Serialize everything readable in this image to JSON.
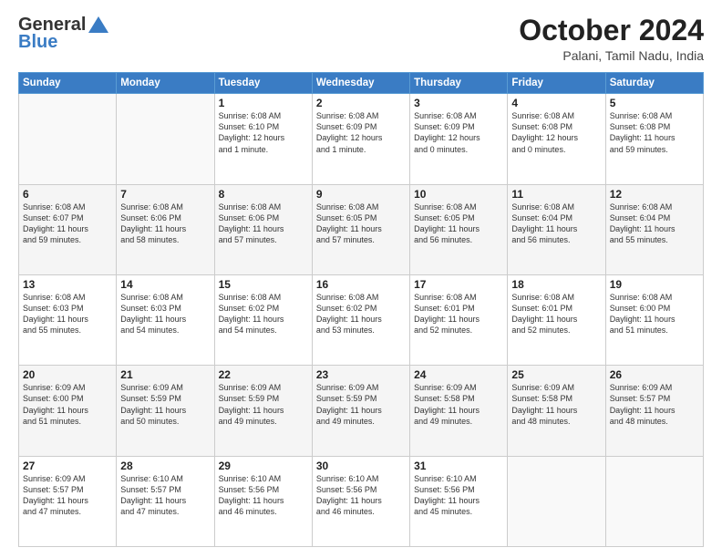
{
  "header": {
    "logo_line1": "General",
    "logo_line2": "Blue",
    "month": "October 2024",
    "location": "Palani, Tamil Nadu, India"
  },
  "weekdays": [
    "Sunday",
    "Monday",
    "Tuesday",
    "Wednesday",
    "Thursday",
    "Friday",
    "Saturday"
  ],
  "weeks": [
    [
      {
        "day": "",
        "text": ""
      },
      {
        "day": "",
        "text": ""
      },
      {
        "day": "1",
        "text": "Sunrise: 6:08 AM\nSunset: 6:10 PM\nDaylight: 12 hours\nand 1 minute."
      },
      {
        "day": "2",
        "text": "Sunrise: 6:08 AM\nSunset: 6:09 PM\nDaylight: 12 hours\nand 1 minute."
      },
      {
        "day": "3",
        "text": "Sunrise: 6:08 AM\nSunset: 6:09 PM\nDaylight: 12 hours\nand 0 minutes."
      },
      {
        "day": "4",
        "text": "Sunrise: 6:08 AM\nSunset: 6:08 PM\nDaylight: 12 hours\nand 0 minutes."
      },
      {
        "day": "5",
        "text": "Sunrise: 6:08 AM\nSunset: 6:08 PM\nDaylight: 11 hours\nand 59 minutes."
      }
    ],
    [
      {
        "day": "6",
        "text": "Sunrise: 6:08 AM\nSunset: 6:07 PM\nDaylight: 11 hours\nand 59 minutes."
      },
      {
        "day": "7",
        "text": "Sunrise: 6:08 AM\nSunset: 6:06 PM\nDaylight: 11 hours\nand 58 minutes."
      },
      {
        "day": "8",
        "text": "Sunrise: 6:08 AM\nSunset: 6:06 PM\nDaylight: 11 hours\nand 57 minutes."
      },
      {
        "day": "9",
        "text": "Sunrise: 6:08 AM\nSunset: 6:05 PM\nDaylight: 11 hours\nand 57 minutes."
      },
      {
        "day": "10",
        "text": "Sunrise: 6:08 AM\nSunset: 6:05 PM\nDaylight: 11 hours\nand 56 minutes."
      },
      {
        "day": "11",
        "text": "Sunrise: 6:08 AM\nSunset: 6:04 PM\nDaylight: 11 hours\nand 56 minutes."
      },
      {
        "day": "12",
        "text": "Sunrise: 6:08 AM\nSunset: 6:04 PM\nDaylight: 11 hours\nand 55 minutes."
      }
    ],
    [
      {
        "day": "13",
        "text": "Sunrise: 6:08 AM\nSunset: 6:03 PM\nDaylight: 11 hours\nand 55 minutes."
      },
      {
        "day": "14",
        "text": "Sunrise: 6:08 AM\nSunset: 6:03 PM\nDaylight: 11 hours\nand 54 minutes."
      },
      {
        "day": "15",
        "text": "Sunrise: 6:08 AM\nSunset: 6:02 PM\nDaylight: 11 hours\nand 54 minutes."
      },
      {
        "day": "16",
        "text": "Sunrise: 6:08 AM\nSunset: 6:02 PM\nDaylight: 11 hours\nand 53 minutes."
      },
      {
        "day": "17",
        "text": "Sunrise: 6:08 AM\nSunset: 6:01 PM\nDaylight: 11 hours\nand 52 minutes."
      },
      {
        "day": "18",
        "text": "Sunrise: 6:08 AM\nSunset: 6:01 PM\nDaylight: 11 hours\nand 52 minutes."
      },
      {
        "day": "19",
        "text": "Sunrise: 6:08 AM\nSunset: 6:00 PM\nDaylight: 11 hours\nand 51 minutes."
      }
    ],
    [
      {
        "day": "20",
        "text": "Sunrise: 6:09 AM\nSunset: 6:00 PM\nDaylight: 11 hours\nand 51 minutes."
      },
      {
        "day": "21",
        "text": "Sunrise: 6:09 AM\nSunset: 5:59 PM\nDaylight: 11 hours\nand 50 minutes."
      },
      {
        "day": "22",
        "text": "Sunrise: 6:09 AM\nSunset: 5:59 PM\nDaylight: 11 hours\nand 49 minutes."
      },
      {
        "day": "23",
        "text": "Sunrise: 6:09 AM\nSunset: 5:59 PM\nDaylight: 11 hours\nand 49 minutes."
      },
      {
        "day": "24",
        "text": "Sunrise: 6:09 AM\nSunset: 5:58 PM\nDaylight: 11 hours\nand 49 minutes."
      },
      {
        "day": "25",
        "text": "Sunrise: 6:09 AM\nSunset: 5:58 PM\nDaylight: 11 hours\nand 48 minutes."
      },
      {
        "day": "26",
        "text": "Sunrise: 6:09 AM\nSunset: 5:57 PM\nDaylight: 11 hours\nand 48 minutes."
      }
    ],
    [
      {
        "day": "27",
        "text": "Sunrise: 6:09 AM\nSunset: 5:57 PM\nDaylight: 11 hours\nand 47 minutes."
      },
      {
        "day": "28",
        "text": "Sunrise: 6:10 AM\nSunset: 5:57 PM\nDaylight: 11 hours\nand 47 minutes."
      },
      {
        "day": "29",
        "text": "Sunrise: 6:10 AM\nSunset: 5:56 PM\nDaylight: 11 hours\nand 46 minutes."
      },
      {
        "day": "30",
        "text": "Sunrise: 6:10 AM\nSunset: 5:56 PM\nDaylight: 11 hours\nand 46 minutes."
      },
      {
        "day": "31",
        "text": "Sunrise: 6:10 AM\nSunset: 5:56 PM\nDaylight: 11 hours\nand 45 minutes."
      },
      {
        "day": "",
        "text": ""
      },
      {
        "day": "",
        "text": ""
      }
    ]
  ]
}
